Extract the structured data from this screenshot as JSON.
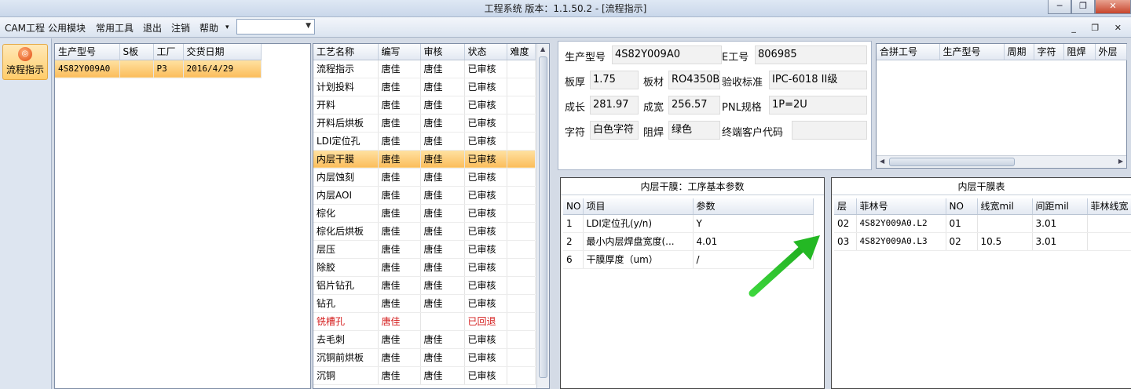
{
  "window": {
    "title": "工程系统   版本：1.1.50.2 - [流程指示]"
  },
  "menu": {
    "items": [
      "CAM工程",
      "公用模块",
      "常用工具",
      "退出",
      "注销",
      "帮助"
    ],
    "help_arrow": "▾",
    "combo_value": ""
  },
  "sidebar": {
    "flow_button_label": "流程指示"
  },
  "orders": {
    "headers": [
      "生产型号",
      "S板",
      "工厂",
      "交货日期"
    ],
    "rows": [
      [
        "4S82Y009A0",
        "",
        "P3",
        "2016/4/29"
      ]
    ]
  },
  "process": {
    "headers": [
      "工艺名称",
      "编写",
      "审核",
      "状态",
      "难度"
    ],
    "rows": [
      [
        "流程指示",
        "唐佳",
        "唐佳",
        "已审核",
        ""
      ],
      [
        "计划投料",
        "唐佳",
        "唐佳",
        "已审核",
        ""
      ],
      [
        "开料",
        "唐佳",
        "唐佳",
        "已审核",
        ""
      ],
      [
        "开料后烘板",
        "唐佳",
        "唐佳",
        "已审核",
        ""
      ],
      [
        "LDI定位孔",
        "唐佳",
        "唐佳",
        "已审核",
        ""
      ],
      [
        "内层干膜",
        "唐佳",
        "唐佳",
        "已审核",
        ""
      ],
      [
        "内层蚀刻",
        "唐佳",
        "唐佳",
        "已审核",
        ""
      ],
      [
        "内层AOI",
        "唐佳",
        "唐佳",
        "已审核",
        ""
      ],
      [
        "棕化",
        "唐佳",
        "唐佳",
        "已审核",
        ""
      ],
      [
        "棕化后烘板",
        "唐佳",
        "唐佳",
        "已审核",
        ""
      ],
      [
        "层压",
        "唐佳",
        "唐佳",
        "已审核",
        ""
      ],
      [
        "除胶",
        "唐佳",
        "唐佳",
        "已审核",
        ""
      ],
      [
        "铝片钻孔",
        "唐佳",
        "唐佳",
        "已审核",
        ""
      ],
      [
        "钻孔",
        "唐佳",
        "唐佳",
        "已审核",
        ""
      ],
      [
        "铣槽孔",
        "唐佳",
        "",
        "已回退",
        ""
      ],
      [
        "去毛刺",
        "唐佳",
        "唐佳",
        "已审核",
        ""
      ],
      [
        "沉铜前烘板",
        "唐佳",
        "唐佳",
        "已审核",
        ""
      ],
      [
        "沉铜",
        "唐佳",
        "唐佳",
        "已审核",
        ""
      ]
    ],
    "selected_index": 5,
    "rejected_index": 14
  },
  "info": {
    "model_label": "生产型号",
    "model_value": "4S82Y009A0",
    "eno_label": "E工号",
    "eno_value": "806985",
    "thickness_label": "板厚",
    "thickness_value": "1.75",
    "material_label": "板材",
    "material_value": "RO4350B",
    "standard_label": "验收标准",
    "standard_value": "IPC-6018 II级",
    "length_label": "成长",
    "length_value": "281.97",
    "width_label": "成宽",
    "width_value": "256.57",
    "pnl_label": "PNL规格",
    "pnl_value": "1P=2U",
    "char_label": "字符",
    "char_value": "白色字符",
    "mask_label": "阻焊",
    "mask_value": "绿色",
    "customer_label": "终端客户代码",
    "customer_value": ""
  },
  "merge": {
    "headers": [
      "合拼工号",
      "生产型号",
      "周期",
      "字符",
      "阻焊",
      "外层"
    ]
  },
  "params": {
    "title": "内层干膜：工序基本参数",
    "headers": [
      "NO",
      "项目",
      "参数"
    ],
    "rows": [
      [
        "1",
        "LDI定位孔(y/n)",
        "Y"
      ],
      [
        "2",
        "最小内层焊盘宽度(...",
        "4.01"
      ],
      [
        "6",
        "干膜厚度（um）",
        "/"
      ]
    ]
  },
  "filmtable": {
    "title": "内层干膜表",
    "headers": [
      "层",
      "菲林号",
      "NO",
      "线宽mil",
      "间距mil",
      "菲林线宽"
    ],
    "rows": [
      [
        "02",
        "4S82Y009A0.L2",
        "01",
        "",
        "3.01",
        ""
      ],
      [
        "03",
        "4S82Y009A0.L3",
        "02",
        "10.5",
        "3.01",
        ""
      ]
    ]
  },
  "colors": {
    "arrow": "#22c522",
    "selected_row": "#fbbd5c",
    "rejected_text": "#d41b1b"
  }
}
